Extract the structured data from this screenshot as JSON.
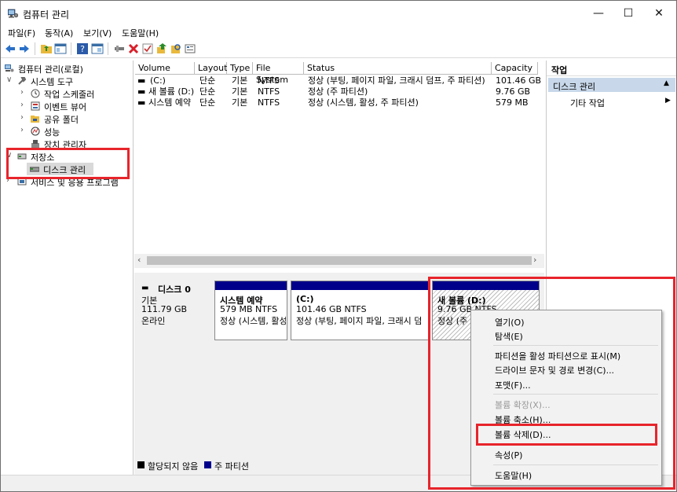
{
  "window": {
    "title": "컴퓨터 관리",
    "minimize": "—",
    "maximize": "☐",
    "close": "✕"
  },
  "menu": [
    "파일(F)",
    "동작(A)",
    "보기(V)",
    "도움말(H)"
  ],
  "toolbar_icons": [
    "back-icon",
    "forward-icon",
    "up-folder-icon",
    "show-hide-tree-icon",
    "help-icon",
    "console-icon",
    "connect-icon",
    "delete-icon",
    "check-icon",
    "export-icon",
    "find-icon",
    "properties-icon"
  ],
  "tree": {
    "root": "컴퓨터 관리(로컬)",
    "system_tools": "시스템 도구",
    "task_scheduler": "작업 스케줄러",
    "event_viewer": "이벤트 뷰어",
    "shared_folders": "공유 폴더",
    "performance": "성능",
    "device_manager": "장치 관리자",
    "storage": "저장소",
    "disk_management": "디스크 관리",
    "services": "서비스 및 응용 프로그램"
  },
  "volume_table": {
    "columns": [
      "Volume",
      "Layout",
      "Type",
      "File System",
      "Status",
      "Capacity"
    ],
    "rows": [
      {
        "volume": "(C:)",
        "layout": "단순",
        "type": "기본",
        "fs": "NTFS",
        "status": "정상 (부팅, 페이지 파일, 크래시 덤프, 주 파티션)",
        "capacity": "101.46 GB"
      },
      {
        "volume": "새 볼륨 (D:)",
        "layout": "단순",
        "type": "기본",
        "fs": "NTFS",
        "status": "정상 (주 파티션)",
        "capacity": "9.76 GB"
      },
      {
        "volume": "시스템 예약",
        "layout": "단순",
        "type": "기본",
        "fs": "NTFS",
        "status": "정상 (시스템, 활성, 주 파티션)",
        "capacity": "579 MB"
      }
    ]
  },
  "disk": {
    "name": "디스크 0",
    "type": "기본",
    "size": "111.79 GB",
    "state": "온라인",
    "partitions": [
      {
        "name": "시스템 예약",
        "size": "579 MB NTFS",
        "status": "정상 (시스템, 활성"
      },
      {
        "name": "(C:)",
        "size": "101.46 GB NTFS",
        "status": "정상 (부팅, 페이지 파일, 크래시 덤"
      },
      {
        "name": "새 볼륨  (D:)",
        "size": "9.76 GB NTFS",
        "status": "정상 (주 파"
      }
    ]
  },
  "legend": {
    "unallocated": "할당되지 않음",
    "primary": "주 파티션"
  },
  "actions": {
    "header": "작업",
    "section": "디스크 관리",
    "more": "기타 작업"
  },
  "context_menu": {
    "open": "열기(O)",
    "explore": "탐색(E)",
    "mark_active": "파티션을 활성 파티션으로 표시(M)",
    "change_letter": "드라이브 문자 및 경로 변경(C)...",
    "format": "포맷(F)...",
    "extend": "볼륨 확장(X)...",
    "shrink": "볼륨 축소(H)...",
    "delete": "볼륨 삭제(D)...",
    "properties": "속성(P)",
    "help": "도움말(H)"
  },
  "colors": {
    "primary_partition": "#00008b",
    "unallocated": "#000000",
    "highlight_box": "#e8242b",
    "action_header_bg": "#c8d8ea"
  }
}
